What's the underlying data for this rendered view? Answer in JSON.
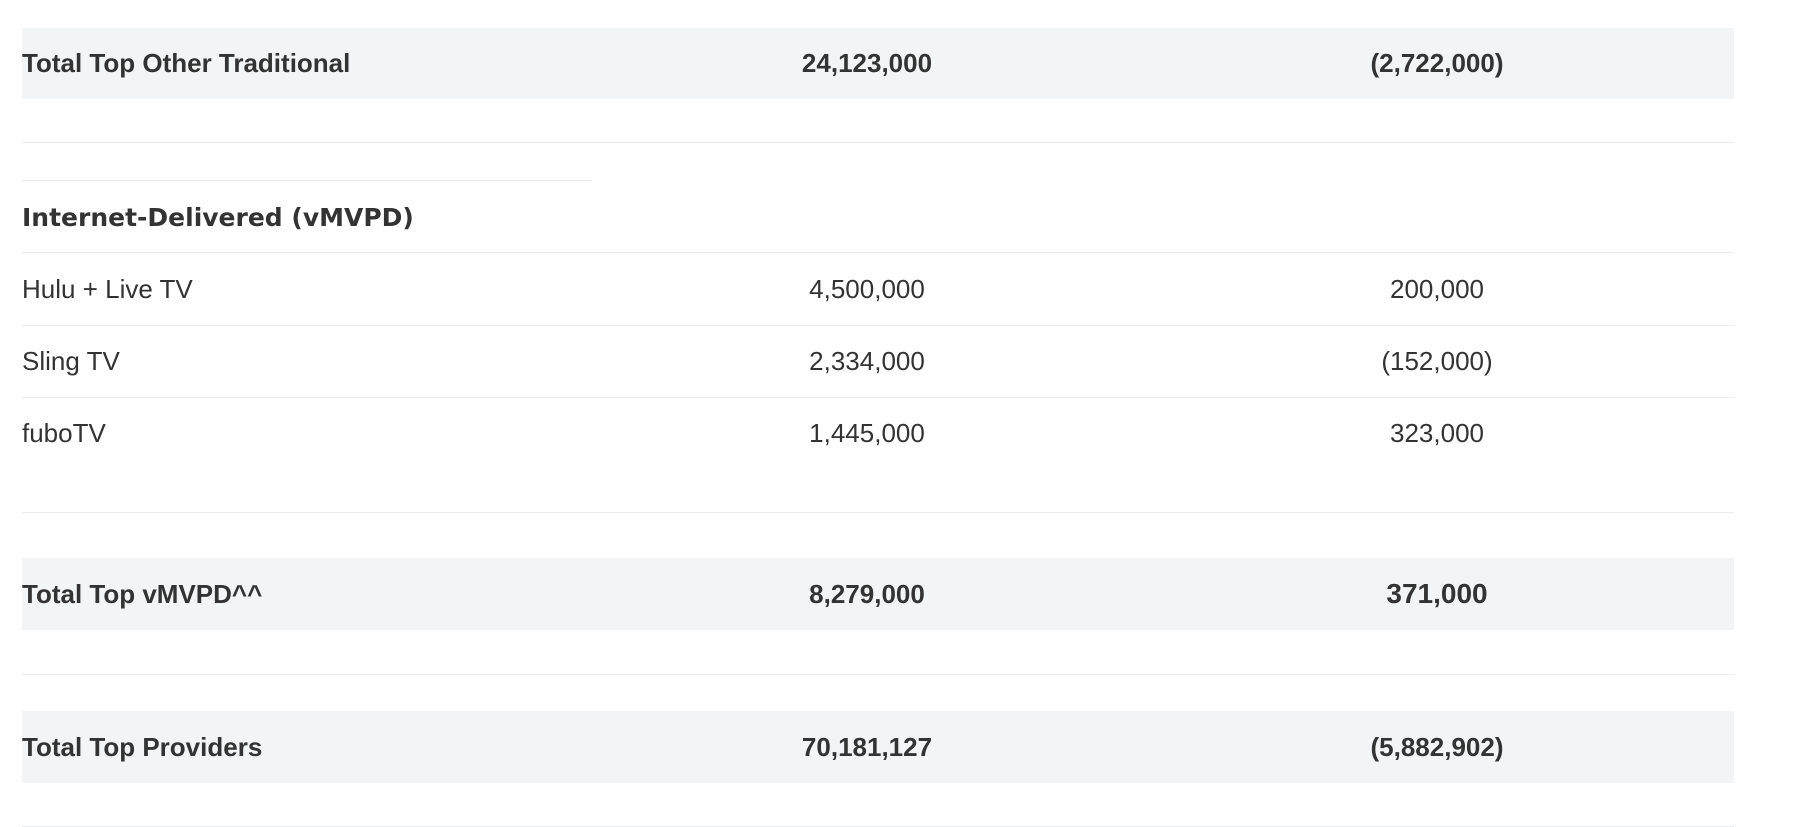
{
  "rows": [
    {
      "label": "Total Top Other Traditional",
      "subscribers": "24,123,000",
      "net_adds": "(2,722,000)"
    },
    {
      "label": "Internet-Delivered (vMVPD)"
    },
    {
      "label": "Hulu + Live TV",
      "subscribers": "4,500,000",
      "net_adds": "200,000"
    },
    {
      "label": "Sling TV",
      "subscribers": "2,334,000",
      "net_adds": "(152,000)"
    },
    {
      "label": "fuboTV",
      "subscribers": "1,445,000",
      "net_adds": "323,000"
    },
    {
      "label": "Total Top vMVPD^^",
      "subscribers": "8,279,000",
      "net_adds": "371,000"
    },
    {
      "label": "Total Top Providers",
      "subscribers": "70,181,127",
      "net_adds": "(5,882,902)"
    }
  ]
}
